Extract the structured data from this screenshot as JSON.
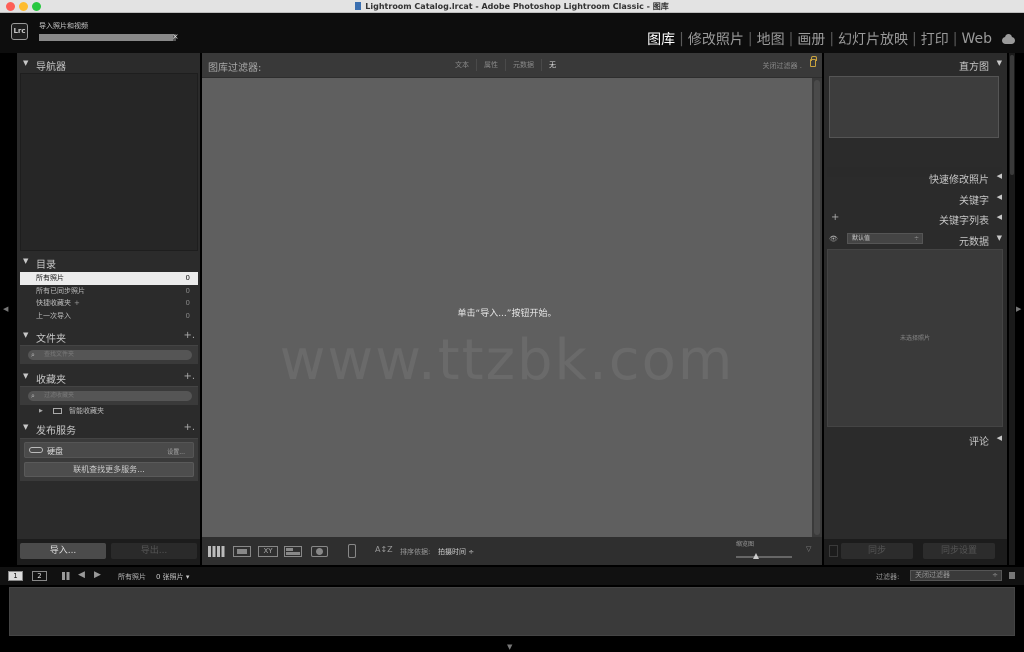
{
  "window": {
    "title": "Lightroom Catalog.lrcat - Adobe Photoshop Lightroom Classic - 图库"
  },
  "identity": {
    "logo": "Lrc",
    "import_label": "导入照片和视频",
    "import_progress": 0.98,
    "close_glyph": "×"
  },
  "modules": [
    {
      "label": "图库",
      "active": true
    },
    {
      "label": "修改照片",
      "active": false
    },
    {
      "label": "地图",
      "active": false
    },
    {
      "label": "画册",
      "active": false
    },
    {
      "label": "幻灯片放映",
      "active": false
    },
    {
      "label": "打印",
      "active": false
    },
    {
      "label": "Web",
      "active": false
    }
  ],
  "left_panel": {
    "navigator": {
      "title": "导航器"
    },
    "catalog": {
      "title": "目录",
      "items": [
        {
          "label": "所有照片",
          "count": "0",
          "selected": true,
          "plus": ""
        },
        {
          "label": "所有已同步照片",
          "count": "0",
          "selected": false,
          "plus": ""
        },
        {
          "label": "快捷收藏夹",
          "count": "0",
          "selected": false,
          "plus": "+"
        },
        {
          "label": "上一次导入",
          "count": "0",
          "selected": false,
          "plus": ""
        }
      ]
    },
    "folders": {
      "title": "文件夹",
      "add": "+.",
      "search_placeholder": "查找文件夹"
    },
    "collections": {
      "title": "收藏夹",
      "add": "+.",
      "search_placeholder": "过滤收藏夹",
      "smart_collections": "智能收藏夹"
    },
    "publish": {
      "title": "发布服务",
      "add": "+.",
      "hard_drive": "硬盘",
      "setup": "设置...",
      "find_more": "联机查找更多服务..."
    },
    "buttons": {
      "import": "导入...",
      "export": "导出..."
    }
  },
  "center": {
    "filter_bar": {
      "title": "图库过滤器:",
      "tabs": [
        {
          "label": "文本",
          "selected": false
        },
        {
          "label": "属性",
          "selected": false
        },
        {
          "label": "元数据",
          "selected": false
        },
        {
          "label": "无",
          "selected": true
        }
      ],
      "close_filter": "关闭过滤器 ."
    },
    "empty_hint": "单击“导入...”按钮开始。",
    "watermark": "www.ttzbk.com",
    "toolbar": {
      "compare_label": "XY",
      "sort_label": "排序依据:",
      "sort_value": "拍摄时间 ÷",
      "sort_icon": "A↕Z",
      "thumbnail_label": "缩览图",
      "thumbnail_size": 0.35
    }
  },
  "right_panel": {
    "histogram": {
      "title": "直方图"
    },
    "quick_develop": {
      "title": "快速修改照片"
    },
    "keywording": {
      "title": "关键字"
    },
    "keyword_list": {
      "title": "关键字列表",
      "add": "+"
    },
    "metadata": {
      "title": "元数据",
      "preset": "默认值",
      "empty_message": "未选择照片"
    },
    "comments": {
      "title": "评论"
    },
    "buttons": {
      "sync": "同步",
      "sync_settings": "同步设置"
    }
  },
  "filmstrip": {
    "view1": "1",
    "view2": "2",
    "source": "所有照片",
    "count": "0 张照片 ▾",
    "filter_label": "过滤器:",
    "filter_value": "关闭过滤器"
  },
  "colors": {
    "active_module": "#ffffff",
    "inactive_module": "#9a9a9a",
    "panel_bg": "#2b2b2b",
    "grid_bg": "#5f5f5f"
  }
}
